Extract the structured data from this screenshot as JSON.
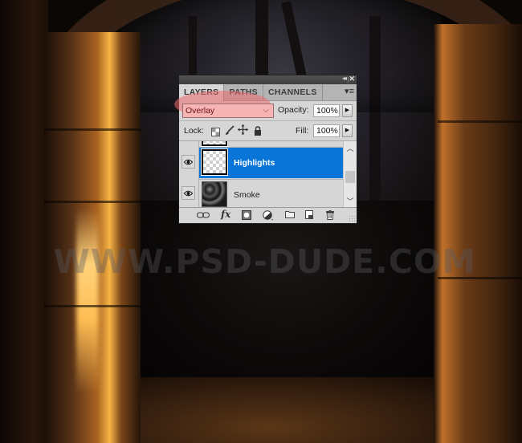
{
  "watermark": "WWW.PSD-DUDE.COM",
  "panel": {
    "titlebar": {
      "collapse_icon": "◂◂",
      "close_icon": "✕"
    },
    "tabs": [
      {
        "label": "LAYERS",
        "active": true
      },
      {
        "label": "PATHS",
        "active": false
      },
      {
        "label": "CHANNELS",
        "active": false
      }
    ],
    "menu_icon": "▾≡",
    "blend_mode": {
      "value": "Overlay",
      "highlighted_color": "#ee696e"
    },
    "opacity": {
      "label": "Opacity:",
      "value": "100%"
    },
    "lock": {
      "label": "Lock:",
      "icons": [
        "lock-transparency-icon",
        "lock-image-icon",
        "lock-position-icon",
        "lock-all-icon"
      ]
    },
    "fill": {
      "label": "Fill:",
      "value": "100%"
    },
    "layers": [
      {
        "name": "Highlights",
        "visible": true,
        "selected": true,
        "thumbnail": "transparent"
      },
      {
        "name": "Smoke",
        "visible": true,
        "selected": false,
        "thumbnail": "smoke-texture"
      }
    ],
    "footer_icons": [
      "link-layers-icon",
      "fx-icon",
      "layer-mask-icon",
      "adjustment-layer-icon",
      "new-group-icon",
      "new-layer-icon",
      "trash-icon"
    ],
    "colors": {
      "selected_row": "#0a75d8",
      "panel_bg": "#d6d6d6"
    }
  },
  "glyphs": {
    "chevron_down": "⌵",
    "arrow_right": "▶",
    "scroll_up": "︿",
    "scroll_down": "﹀",
    "fx": "fx",
    "move": "✥"
  }
}
